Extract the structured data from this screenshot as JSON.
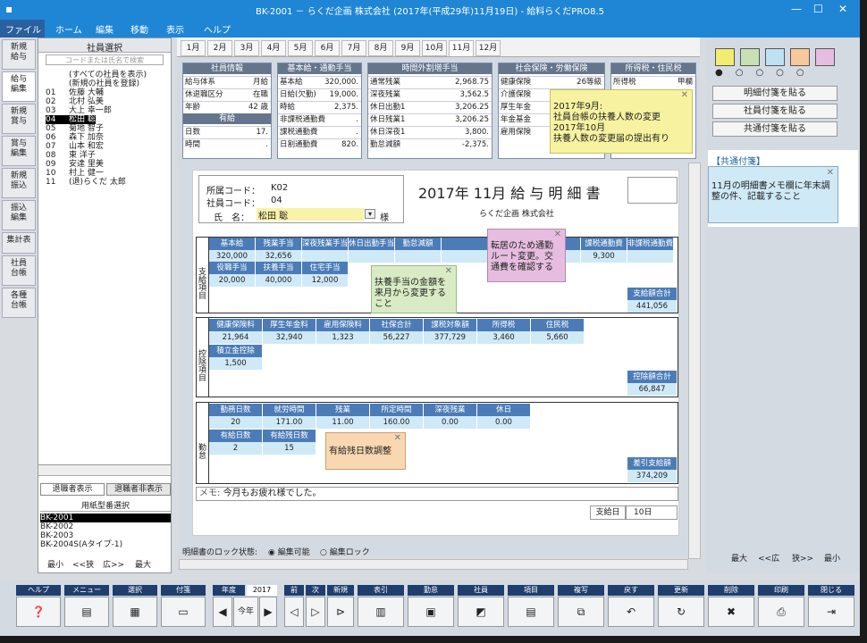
{
  "title": "BK-2001 － らくだ企画 株式会社 (2017年(平成29年)11月19日) - 給料らくだPRO8.5",
  "menu": [
    "ファイル",
    "ホーム",
    "編集",
    "移動",
    "表示",
    "ヘルプ"
  ],
  "vtabs": [
    "新規\n給与",
    "給与\n編集",
    "新規\n賞与",
    "賞与\n編集",
    "新規\n振込",
    "振込\n編集",
    "集計表",
    "社員\n台帳",
    "各種\n台帳"
  ],
  "emp_header": "社員選択",
  "search_placeholder": "コードまたは氏名で検索",
  "employees": [
    {
      "no": "",
      "name": "(すべての社員を表示)"
    },
    {
      "no": "",
      "name": "(新規の社員を登録)"
    },
    {
      "no": "01",
      "name": "佐藤 大輔"
    },
    {
      "no": "02",
      "name": "北村 弘美"
    },
    {
      "no": "03",
      "name": "大上 幸一郎"
    },
    {
      "no": "04",
      "name": "松田 聡"
    },
    {
      "no": "05",
      "name": "菊地 智子"
    },
    {
      "no": "06",
      "name": "森下 加奈"
    },
    {
      "no": "07",
      "name": "山本 和宏"
    },
    {
      "no": "08",
      "name": "東 洋子"
    },
    {
      "no": "09",
      "name": "安達 里美"
    },
    {
      "no": "10",
      "name": "村上 健一"
    },
    {
      "no": "11",
      "name": "(退)らくだ 太郎"
    }
  ],
  "retire_tabs": [
    "退職者表示",
    "退職者非表示"
  ],
  "paper_header": "用紙型番選択",
  "papers": [
    "BK-2001",
    "BK-2002",
    "BK-2003",
    "BK-2004S(Aタイプ-1)"
  ],
  "zoom_left": [
    "最小",
    "<<狭",
    "広>>",
    "最大"
  ],
  "months": [
    "1月",
    "2月",
    "3月",
    "4月",
    "5月",
    "6月",
    "7月",
    "8月",
    "9月",
    "10月",
    "11月",
    "12月"
  ],
  "info": {
    "kyuyo": {
      "title": "社員情報",
      "rows": [
        [
          "給与体系",
          "月給"
        ],
        [
          "休退職区分",
          "在職"
        ],
        [
          "年齢",
          "42 歳"
        ]
      ],
      "sub": "有給",
      "rows2": [
        [
          "日数",
          "17."
        ],
        [
          "時間",
          "."
        ]
      ]
    },
    "kihon": {
      "title": "基本給・通勤手当",
      "rows": [
        [
          "基本給",
          "320,000."
        ],
        [
          "日給(欠勤)",
          "19,000."
        ],
        [
          "時給",
          "2,375."
        ],
        [
          "非課税通勤費",
          "."
        ],
        [
          "課税通勤費",
          "."
        ],
        [
          "日割通勤費",
          "820."
        ]
      ]
    },
    "jikan": {
      "title": "時間外割増手当",
      "rows": [
        [
          "通常残業",
          "2,968.75"
        ],
        [
          "深夜残業",
          "3,562.5"
        ],
        [
          "休日出勤1",
          "3,206.25"
        ],
        [
          "休日残業1",
          "3,206.25"
        ],
        [
          "休日深夜1",
          "3,800."
        ],
        [
          "勤怠減額",
          "-2,375."
        ]
      ]
    },
    "shakai": {
      "title": "社会保険・労働保険",
      "rows": [
        [
          "健康保険",
          "26等級"
        ],
        [
          "介護保険",
          ""
        ],
        [
          "厚生年金",
          ""
        ],
        [
          "年金基金",
          ""
        ],
        [
          "雇用保険",
          ""
        ]
      ]
    },
    "shotoku": {
      "title": "所得税・住民税",
      "rows": [
        [
          "所得税",
          "甲欄"
        ]
      ]
    }
  },
  "slip": {
    "code_label": "所属コード：",
    "code": "K02",
    "emp_label": "社員コード：",
    "emp": "04",
    "name_label": "氏　名：",
    "name": "松田 聡",
    "sama": "様",
    "title": "2017年 11月 給 与 明 細 書",
    "company": "らくだ企画 株式会社",
    "pay_label": "支給項目",
    "pay_head1": [
      "基本給",
      "残業手当",
      "深夜残業手当",
      "休日出勤手当",
      "勤怠減額",
      "",
      "",
      "",
      "課税通勤費",
      "非課税通勤費"
    ],
    "pay_val1": [
      "320,000",
      "32,656",
      "",
      "",
      "",
      "",
      "",
      "",
      "9,300",
      ""
    ],
    "pay_head2": [
      "役職手当",
      "扶養手当",
      "住宅手当"
    ],
    "pay_val2": [
      "20,000",
      "40,000",
      "12,000"
    ],
    "pay_total_label": "支給額合計",
    "pay_total": "441,056",
    "ded_label": "控除項目",
    "ded_head": [
      "健康保険料",
      "厚生年金料",
      "雇用保険料",
      "社保合計",
      "課税対象額",
      "所得税",
      "住民税"
    ],
    "ded_val": [
      "21,964",
      "32,940",
      "1,323",
      "56,227",
      "377,729",
      "3,460",
      "5,660"
    ],
    "ded_head2": "積立金控除",
    "ded_val2": "1,500",
    "ded_total_label": "控除額合計",
    "ded_total": "66,847",
    "att_label": "勤怠",
    "att_head": [
      "勤務日数",
      "就労時間",
      "残業",
      "所定時間",
      "深夜残業",
      "休日"
    ],
    "att_val": [
      "20",
      "171.00",
      "11.00",
      "160.00",
      "0.00",
      "0.00"
    ],
    "att_head2": [
      "有給日数",
      "有給残日数"
    ],
    "att_val2": [
      "2",
      "15"
    ],
    "net_label": "差引支給額",
    "net": "374,209",
    "memo_label": "メモ:",
    "memo": "今月もお疲れ様でした。",
    "payday_label": "支給日",
    "payday": "10日"
  },
  "notes": {
    "n1": "2017年9月:\n社員台帳の扶養人数の変更\n2017年10月\n扶養人数の変更届の提出有り",
    "n2": "転居のため通勤\nルート変更。交\n通費を確認する",
    "n3": "扶養手当の金額を\n来月から変更する\nこと",
    "n4": "有給残日数調整",
    "kyotsu_title": "【共通付箋】",
    "kyotsu": "11月の明細書メモ欄に年末調整の件、記載すること"
  },
  "lock": {
    "label": "明細書のロック状態:",
    "opt1": "編集可能",
    "opt2": "編集ロック"
  },
  "right_buttons": [
    "明細付箋を貼る",
    "社員付箋を貼る",
    "共通付箋を貼る"
  ],
  "right_zoom": [
    "最大",
    "<<広",
    "狭>>",
    "最小"
  ],
  "toolbar": {
    "labels": [
      "ヘルプ",
      "メニュー",
      "選択",
      "付箋",
      "年度",
      "2017",
      "前",
      "次",
      "新規",
      "表引",
      "勤怠",
      "社員",
      "項目",
      "複写",
      "戻す",
      "更新",
      "削除",
      "印刷",
      "閉じる"
    ],
    "year_btn": "今年"
  },
  "colors": {
    "title": "#1f86d6",
    "header": "#4b7cb8",
    "cell": "#cfe9f7",
    "note_yellow": "#f7f2a0",
    "note_pink": "#e6bde0",
    "note_green": "#d8ebc4",
    "note_orange": "#f9d7b0",
    "note_blue": "#cfe9f7"
  }
}
